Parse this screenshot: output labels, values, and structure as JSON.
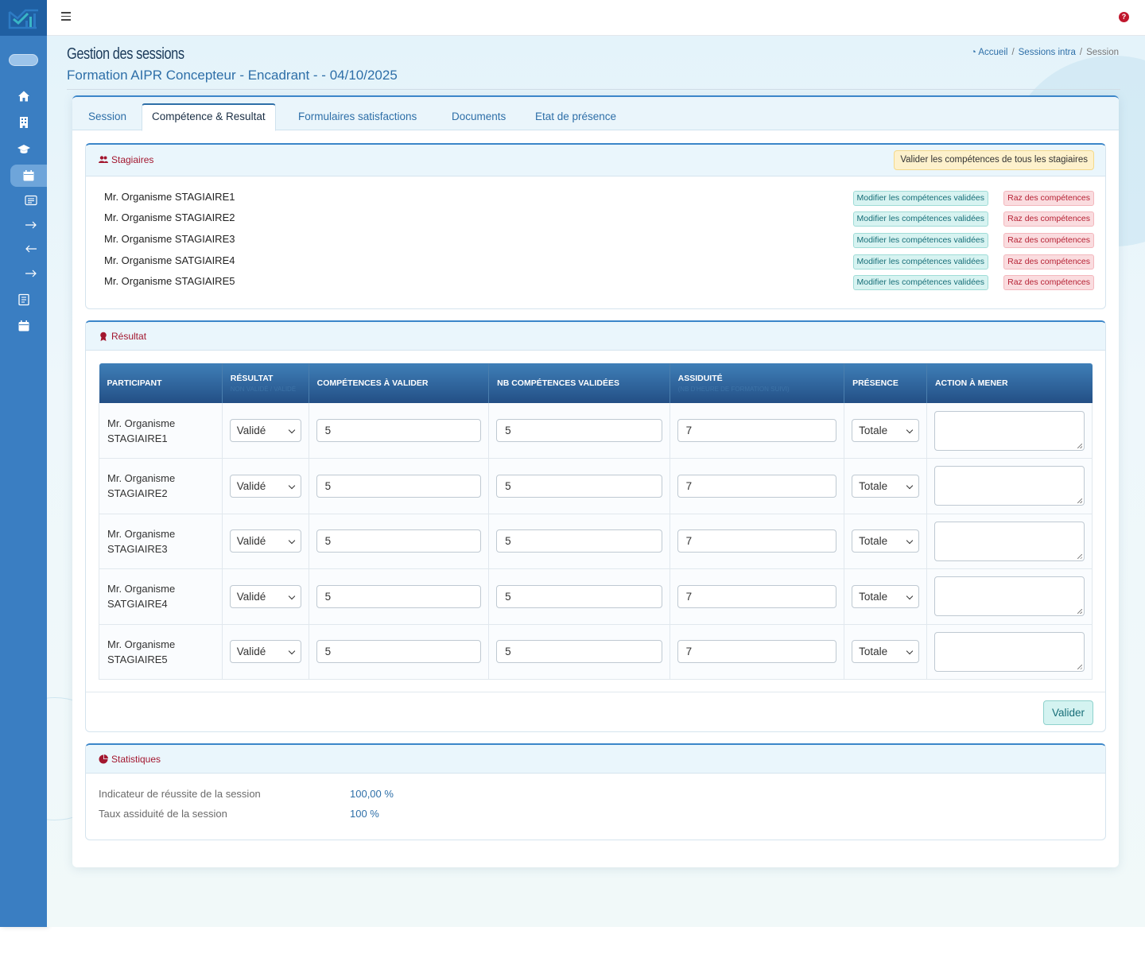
{
  "sidebar": {
    "items": [
      {
        "icon": "home-icon"
      },
      {
        "icon": "building-icon"
      },
      {
        "icon": "graduation-cap-icon"
      },
      {
        "icon": "calendar-icon",
        "active": true
      },
      {
        "icon": "list-card-icon"
      },
      {
        "icon": "arrow-right-icon"
      },
      {
        "icon": "arrow-left-icon"
      },
      {
        "icon": "arrow-right-icon"
      },
      {
        "icon": "document-icon"
      },
      {
        "icon": "calendar-icon"
      }
    ]
  },
  "header": {
    "title": "Gestion des sessions",
    "subtitle": "Formation AIPR Concepteur - Encadrant - - 04/10/2025",
    "breadcrumb": {
      "home": "Accueil",
      "parent": "Sessions intra",
      "current": "Session",
      "separator": "/"
    }
  },
  "tabs": [
    {
      "label": "Session"
    },
    {
      "label": "Compétence & Resultat",
      "active": true
    },
    {
      "label": "Formulaires satisfactions"
    },
    {
      "label": "Documents"
    },
    {
      "label": "Etat de présence"
    }
  ],
  "stagiaires": {
    "title": "Stagiaires",
    "validate_all_label": "Valider les compétences de tous les stagiaires",
    "modify_label": "Modifier les compétences validées",
    "raz_label": "Raz des compétences",
    "names": [
      "Mr. Organisme STAGIAIRE1",
      "Mr. Organisme STAGIAIRE2",
      "Mr. Organisme STAGIAIRE3",
      "Mr. Organisme SATGIAIRE4",
      "Mr. Organisme STAGIAIRE5"
    ]
  },
  "resultat": {
    "title": "Résultat",
    "columns": {
      "participant": "PARTICIPANT",
      "resultat": "RÉSULTAT",
      "resultat_sub": "NON VALIDÉ / VALIDÉ",
      "competences": "COMPÉTENCES À VALIDER",
      "nb_validees": "NB COMPÉTENCES VALIDÉES",
      "assiduite": "ASSIDUITÉ",
      "assiduite_sub": "(NB D'HEURE DE FORMATION SUIVI)",
      "presence": "PRÉSENCE",
      "action": "ACTION À MENER"
    },
    "rows": [
      {
        "name1": "Mr. Organisme",
        "name2": "STAGIAIRE1",
        "resultat": "Validé",
        "competences": "5",
        "nb_validees": "5",
        "assiduite": "7",
        "presence": "Totale",
        "action": ""
      },
      {
        "name1": "Mr. Organisme",
        "name2": "STAGIAIRE2",
        "resultat": "Validé",
        "competences": "5",
        "nb_validees": "5",
        "assiduite": "7",
        "presence": "Totale",
        "action": ""
      },
      {
        "name1": "Mr. Organisme",
        "name2": "STAGIAIRE3",
        "resultat": "Validé",
        "competences": "5",
        "nb_validees": "5",
        "assiduite": "7",
        "presence": "Totale",
        "action": ""
      },
      {
        "name1": "Mr. Organisme",
        "name2": "SATGIAIRE4",
        "resultat": "Validé",
        "competences": "5",
        "nb_validees": "5",
        "assiduite": "7",
        "presence": "Totale",
        "action": ""
      },
      {
        "name1": "Mr. Organisme",
        "name2": "STAGIAIRE5",
        "resultat": "Validé",
        "competences": "5",
        "nb_validees": "5",
        "assiduite": "7",
        "presence": "Totale",
        "action": ""
      }
    ],
    "submit_label": "Valider"
  },
  "statistiques": {
    "title": "Statistiques",
    "rows": [
      {
        "label": "Indicateur de réussite de la session",
        "value": "100,00 %"
      },
      {
        "label": "Taux assiduité de la session",
        "value": "100 %"
      }
    ]
  },
  "colors": {
    "sidebar": "#3a7ec2",
    "accent": "#2e6fa8",
    "panel_title": "#a3172f",
    "table_header": "#234f85"
  }
}
